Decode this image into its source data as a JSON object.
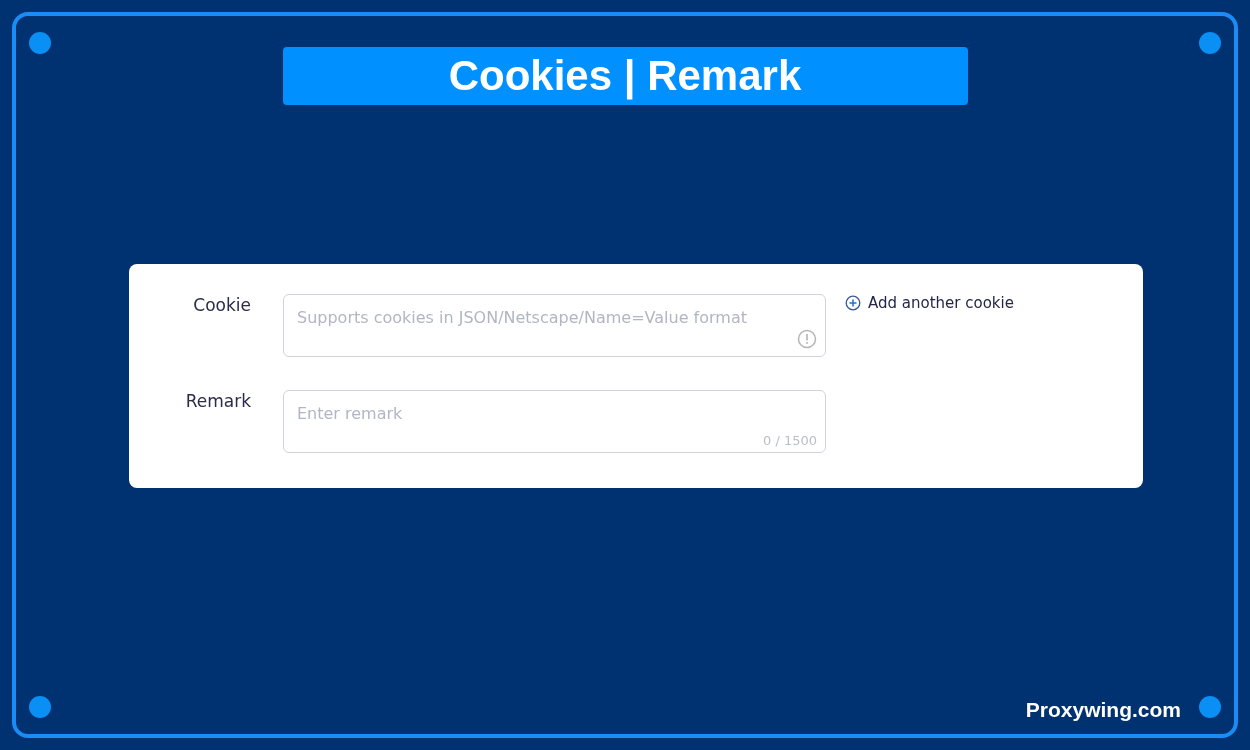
{
  "title": "Cookies | Remark",
  "form": {
    "fields": [
      {
        "kind": "cookie",
        "label": "Cookie",
        "placeholder": "Supports cookies in JSON/Netscape/Name=Value format",
        "action": "Add another cookie"
      },
      {
        "kind": "remark",
        "label": "Remark",
        "placeholder": "Enter remark",
        "counter": "0 / 1500"
      }
    ]
  },
  "footer": "Proxywing.com"
}
